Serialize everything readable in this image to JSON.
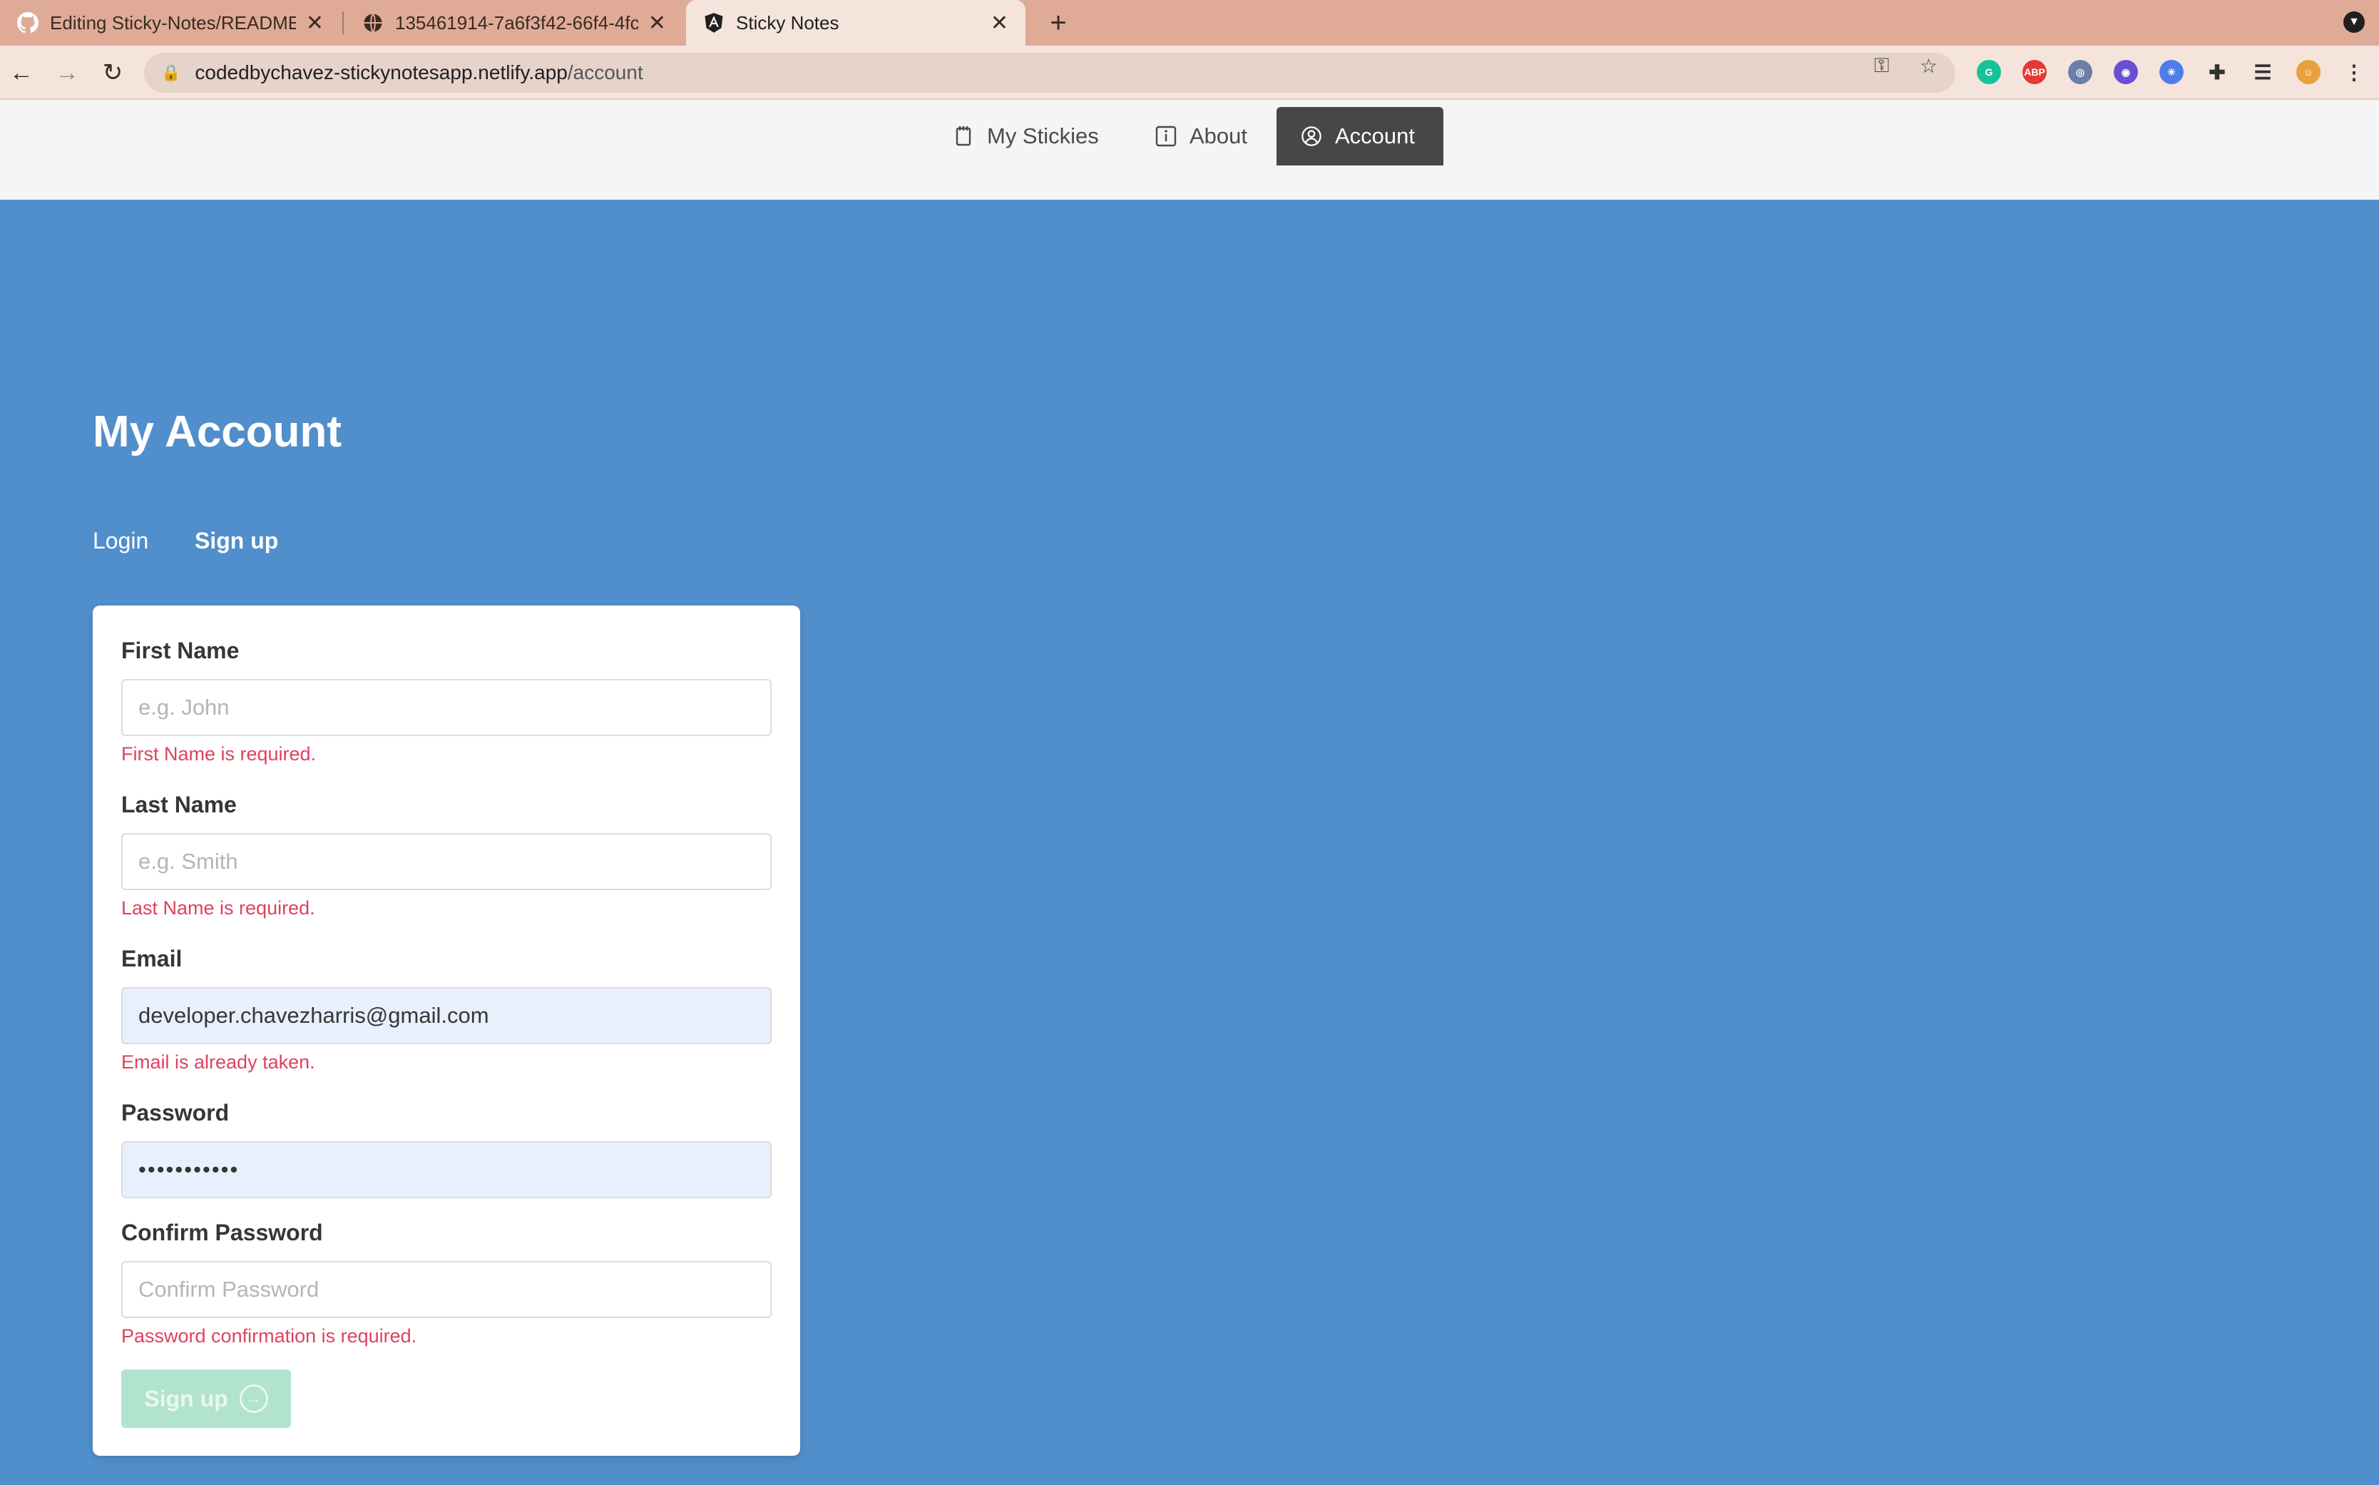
{
  "browser": {
    "tabs": [
      {
        "title": "Editing Sticky-Notes/README.m",
        "icon": "github-icon"
      },
      {
        "title": "135461914-7a6f3f42-66f4-4fc",
        "icon": "globe-icon"
      },
      {
        "title": "Sticky Notes",
        "icon": "angular-icon"
      }
    ],
    "url_host": "codedbychavez-stickynotesapp.netlify.app",
    "url_path": "/account"
  },
  "nav": {
    "my_stickies": "My Stickies",
    "about": "About",
    "account": "Account"
  },
  "page": {
    "title": "My Account",
    "tabs": {
      "login": "Login",
      "signup": "Sign up"
    }
  },
  "form": {
    "first_name": {
      "label": "First Name",
      "placeholder": "e.g. John",
      "value": "",
      "error": "First Name is required."
    },
    "last_name": {
      "label": "Last Name",
      "placeholder": "e.g. Smith",
      "value": "",
      "error": "Last Name is required."
    },
    "email": {
      "label": "Email",
      "placeholder": "",
      "value": "developer.chavezharris@gmail.com",
      "error": "Email is already taken."
    },
    "password": {
      "label": "Password",
      "placeholder": "",
      "value": "•••••••••••"
    },
    "confirm_password": {
      "label": "Confirm Password",
      "placeholder": "Confirm Password",
      "value": "",
      "error": "Password confirmation is required."
    },
    "submit_label": "Sign up"
  },
  "colors": {
    "page_bg": "#518ecc",
    "nav_active": "#474747",
    "error": "#e0415d",
    "submit_disabled": "#b1e3cd"
  }
}
